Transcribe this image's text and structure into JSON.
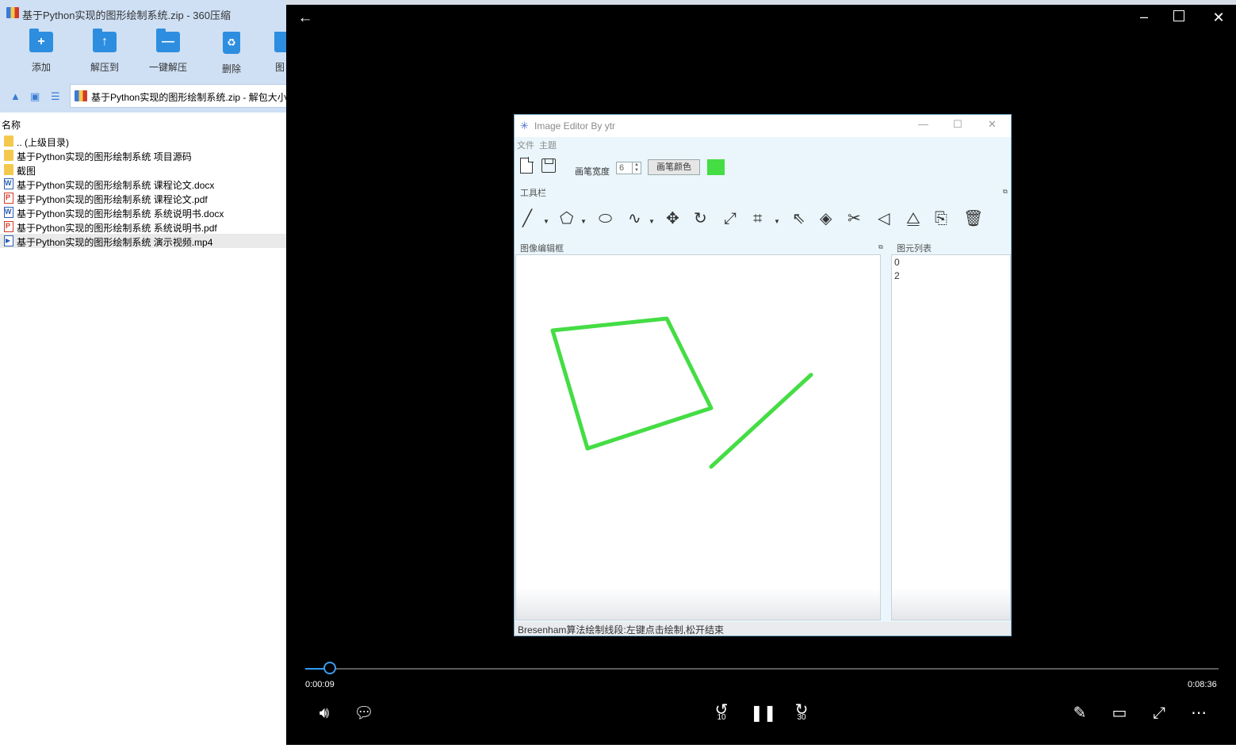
{
  "archiver": {
    "title": "基于Python实现的图形绘制系统.zip - 360压缩",
    "toolbar": [
      {
        "label": "添加",
        "icon": "add-folder-icon",
        "glyph": "+"
      },
      {
        "label": "解压到",
        "icon": "extract-to-icon",
        "glyph": "↑"
      },
      {
        "label": "一键解压",
        "icon": "one-click-extract-icon",
        "glyph": "—"
      },
      {
        "label": "删除",
        "icon": "recycle-bin-icon",
        "glyph": "♻"
      },
      {
        "label": "图",
        "icon": "more-tool-icon",
        "glyph": ""
      }
    ],
    "path": "基于Python实现的图形绘制系统.zip - 解包大小",
    "column_name": "名称",
    "files": [
      {
        "name": ".. (上级目录)",
        "type": "folder"
      },
      {
        "name": "基于Python实现的图形绘制系统 项目源码",
        "type": "folder"
      },
      {
        "name": "截图",
        "type": "folder"
      },
      {
        "name": "基于Python实现的图形绘制系统 课程论文.docx",
        "type": "doc"
      },
      {
        "name": "基于Python实现的图形绘制系统 课程论文.pdf",
        "type": "pdf"
      },
      {
        "name": "基于Python实现的图形绘制系统 系统说明书.docx",
        "type": "doc"
      },
      {
        "name": "基于Python实现的图形绘制系统 系统说明书.pdf",
        "type": "pdf"
      },
      {
        "name": "基于Python实现的图形绘制系统 演示视频.mp4",
        "type": "mp4",
        "selected": true
      }
    ]
  },
  "player": {
    "current_time": "0:00:09",
    "total_time": "0:08:36",
    "progress_fraction": 0.027,
    "skip_back": "10",
    "skip_forward": "30",
    "accent_color": "#2d9cf5"
  },
  "editor": {
    "title": "Image Editor By ytr",
    "menu": [
      "文件",
      "主题"
    ],
    "pen_width_label": "画笔宽度",
    "pen_width_value": "6",
    "pen_color_button": "画笔颜色",
    "pen_color": "#44dd44",
    "toolbar_label": "工具栏",
    "canvas_label": "图像编辑框",
    "list_label": "图元列表",
    "primitives": [
      "0",
      "2"
    ],
    "status": "Bresenham算法绘制线段:左键点击绘制,松开结束",
    "tools": [
      {
        "name": "line-tool-icon",
        "glyph": "╱",
        "dropdown": true
      },
      {
        "name": "polygon-tool-icon",
        "glyph": "⬠",
        "dropdown": true
      },
      {
        "name": "ellipse-tool-icon",
        "glyph": "⬭",
        "dropdown": false
      },
      {
        "name": "curve-tool-icon",
        "glyph": "∿",
        "dropdown": true
      },
      {
        "name": "move-tool-icon",
        "glyph": "✥",
        "dropdown": false
      },
      {
        "name": "rotate-tool-icon",
        "glyph": "↻",
        "dropdown": false
      },
      {
        "name": "scale-tool-icon",
        "glyph": "⤢",
        "dropdown": false
      },
      {
        "name": "clip-tool-icon",
        "glyph": "⌗",
        "dropdown": true
      },
      {
        "name": "select-tool-icon",
        "glyph": "⇖",
        "dropdown": false
      },
      {
        "name": "fill-tool-icon",
        "glyph": "◈",
        "dropdown": false
      },
      {
        "name": "cut-tool-icon",
        "glyph": "✂",
        "dropdown": false
      },
      {
        "name": "flip-horizontal-icon",
        "glyph": "◁",
        "dropdown": false
      },
      {
        "name": "mirror-tool-icon",
        "glyph": "⧋",
        "dropdown": false
      },
      {
        "name": "copy-tool-icon",
        "glyph": "⎘",
        "dropdown": false
      },
      {
        "name": "delete-tool-icon",
        "glyph": "🗑",
        "dropdown": false
      }
    ]
  }
}
